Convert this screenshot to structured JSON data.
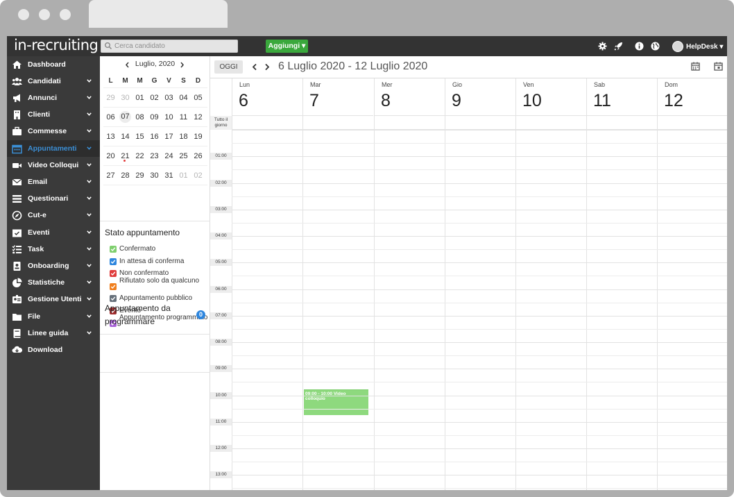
{
  "app": {
    "logo": "in-recruiting",
    "search_placeholder": "Cerca candidato",
    "add_button": "Aggiungi ▾",
    "user_name": "HelpDesk ▾"
  },
  "sidebar": {
    "items": [
      {
        "label": "Dashboard",
        "icon": "home-icon",
        "chevron": false,
        "active": false
      },
      {
        "label": "Candidati",
        "icon": "users-icon",
        "chevron": true,
        "active": false
      },
      {
        "label": "Annunci",
        "icon": "megaphone-icon",
        "chevron": true,
        "active": false
      },
      {
        "label": "Clienti",
        "icon": "building-icon",
        "chevron": true,
        "active": false
      },
      {
        "label": "Commesse",
        "icon": "briefcase-icon",
        "chevron": true,
        "active": false
      },
      {
        "label": "Appuntamenti",
        "icon": "calendar-icon",
        "chevron": true,
        "active": true
      },
      {
        "label": "Video Colloqui",
        "icon": "video-icon",
        "chevron": true,
        "active": false
      },
      {
        "label": "Email",
        "icon": "envelope-icon",
        "chevron": true,
        "active": false
      },
      {
        "label": "Questionari",
        "icon": "list-icon",
        "chevron": true,
        "active": false
      },
      {
        "label": "Cut-e",
        "icon": "compass-icon",
        "chevron": true,
        "active": false
      },
      {
        "label": "Eventi",
        "icon": "calendar-check-icon",
        "chevron": true,
        "active": false
      },
      {
        "label": "Task",
        "icon": "tasks-icon",
        "chevron": true,
        "active": false
      },
      {
        "label": "Onboarding",
        "icon": "id-badge-icon",
        "chevron": true,
        "active": false
      },
      {
        "label": "Statistiche",
        "icon": "pie-chart-icon",
        "chevron": true,
        "active": false
      },
      {
        "label": "Gestione Utenti",
        "icon": "user-id-icon",
        "chevron": true,
        "active": false
      },
      {
        "label": "File",
        "icon": "folder-icon",
        "chevron": true,
        "active": false
      },
      {
        "label": "Linee guida",
        "icon": "book-icon",
        "chevron": true,
        "active": false
      },
      {
        "label": "Download",
        "icon": "cloud-download-icon",
        "chevron": false,
        "active": false
      }
    ]
  },
  "mini_calendar": {
    "title": "Luglio, 2020",
    "weekdays": [
      "L",
      "M",
      "M",
      "G",
      "V",
      "S",
      "D"
    ],
    "weeks": [
      [
        {
          "d": "29",
          "m": true
        },
        {
          "d": "30",
          "m": true
        },
        {
          "d": "01"
        },
        {
          "d": "02"
        },
        {
          "d": "03"
        },
        {
          "d": "04"
        },
        {
          "d": "05"
        }
      ],
      [
        {
          "d": "06"
        },
        {
          "d": "07",
          "t": true
        },
        {
          "d": "08"
        },
        {
          "d": "09"
        },
        {
          "d": "10"
        },
        {
          "d": "11"
        },
        {
          "d": "12"
        }
      ],
      [
        {
          "d": "13"
        },
        {
          "d": "14"
        },
        {
          "d": "15"
        },
        {
          "d": "16"
        },
        {
          "d": "17"
        },
        {
          "d": "18"
        },
        {
          "d": "19"
        }
      ],
      [
        {
          "d": "20"
        },
        {
          "d": "21"
        },
        {
          "d": "22"
        },
        {
          "d": "23"
        },
        {
          "d": "24"
        },
        {
          "d": "25"
        },
        {
          "d": "26"
        }
      ],
      [
        {
          "d": "27"
        },
        {
          "d": "28"
        },
        {
          "d": "29"
        },
        {
          "d": "30"
        },
        {
          "d": "31"
        },
        {
          "d": "01",
          "m": true
        },
        {
          "d": "02",
          "m": true
        }
      ]
    ]
  },
  "status": {
    "title": "Stato appuntamento",
    "items": [
      {
        "label": "Confermato",
        "color": "#7fcf6e"
      },
      {
        "label": "In attesa di conferma",
        "color": "#2e86de"
      },
      {
        "label": "Non confermato",
        "color": "#e03c3c"
      },
      {
        "label": "Rifiutato solo da qualcuno",
        "color": "#f07f1e"
      },
      {
        "label": "Appuntamento pubblico",
        "color": "#66707a"
      },
      {
        "label": "Evento",
        "color": "#a12d2d"
      },
      {
        "label": "Appuntamento programmato",
        "color": "#a860d8"
      }
    ]
  },
  "to_schedule": {
    "label": "Appuntamento da programmare",
    "count": "0"
  },
  "calendar": {
    "today_button": "OGGI",
    "range": "6 Luglio 2020 - 12 Luglio 2020",
    "allday_label": "Tutto il giorno",
    "days": [
      {
        "name": "Lun",
        "num": "6"
      },
      {
        "name": "Mar",
        "num": "7"
      },
      {
        "name": "Mer",
        "num": "8"
      },
      {
        "name": "Gio",
        "num": "9"
      },
      {
        "name": "Ven",
        "num": "10"
      },
      {
        "name": "Sab",
        "num": "11"
      },
      {
        "name": "Dom",
        "num": "12"
      }
    ],
    "hours": [
      "01:00",
      "02:00",
      "03:00",
      "04:00",
      "05:00",
      "06:00",
      "07:00",
      "08:00",
      "09:00",
      "10:00",
      "11:00",
      "12:00",
      "13:00"
    ],
    "event": {
      "label": "09:00 - 10:00 Video colloquio",
      "color": "#8ed97e"
    }
  }
}
